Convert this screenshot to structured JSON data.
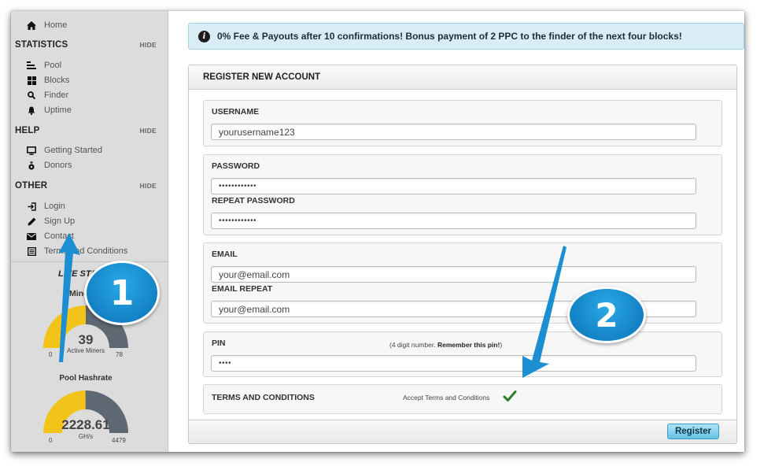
{
  "sidebar": {
    "home_label": "Home",
    "sections": {
      "statistics": {
        "title": "STATISTICS",
        "hide": "HIDE",
        "items": [
          {
            "label": "Pool",
            "icon": "bar-list-icon"
          },
          {
            "label": "Blocks",
            "icon": "grid-icon"
          },
          {
            "label": "Finder",
            "icon": "search-icon"
          },
          {
            "label": "Uptime",
            "icon": "bell-icon"
          }
        ]
      },
      "help": {
        "title": "HELP",
        "hide": "HIDE",
        "items": [
          {
            "label": "Getting Started",
            "icon": "monitor-icon"
          },
          {
            "label": "Donors",
            "icon": "money-bag-icon"
          }
        ]
      },
      "other": {
        "title": "OTHER",
        "hide": "HIDE",
        "items": [
          {
            "label": "Login",
            "icon": "login-icon"
          },
          {
            "label": "Sign Up",
            "icon": "pencil-icon"
          },
          {
            "label": "Contact",
            "icon": "envelope-icon"
          },
          {
            "label": "Terms and Conditions",
            "icon": "document-icon"
          }
        ]
      }
    },
    "live_stats_title": "LIVE STATS",
    "miners_gauge": {
      "title": "Miners",
      "value": "39",
      "unit": "Active Miners",
      "min": "0",
      "max": "78",
      "fraction": 0.5
    },
    "hashrate_gauge": {
      "title": "Pool Hashrate",
      "value": "2228.61",
      "unit": "GH/s",
      "min": "0",
      "max": "4479",
      "fraction": 0.4976
    }
  },
  "notice": {
    "icon": "info-icon",
    "text": "0% Fee & Payouts after 10 confirmations! Bonus payment of 2 PPC to the finder of the next four blocks!"
  },
  "form": {
    "title": "REGISTER NEW ACCOUNT",
    "username": {
      "label": "USERNAME",
      "value": "yourusername123"
    },
    "password": {
      "label": "PASSWORD",
      "value": "••••••••••••"
    },
    "repeat_password": {
      "label": "REPEAT PASSWORD",
      "value": "••••••••••••"
    },
    "email": {
      "label": "EMAIL",
      "value": "your@email.com"
    },
    "email_repeat": {
      "label": "EMAIL REPEAT",
      "value": "your@email.com"
    },
    "pin": {
      "label": "PIN",
      "hint_prefix": "(4 digit number. ",
      "hint_bold": "Remember this pin!",
      "hint_suffix": ")",
      "value": "••••"
    },
    "terms": {
      "label": "TERMS AND CONDITIONS",
      "text": "Accept Terms and Conditions",
      "checked": true
    },
    "submit_label": "Register"
  },
  "annotations": {
    "badge_1": "1",
    "badge_2": "2"
  },
  "colors": {
    "gauge_fill": "#f2c318",
    "gauge_rest": "#5e6873",
    "accent": "#1b8fd2",
    "check": "#2f7d2f",
    "notice_bg": "#d9edf7"
  }
}
